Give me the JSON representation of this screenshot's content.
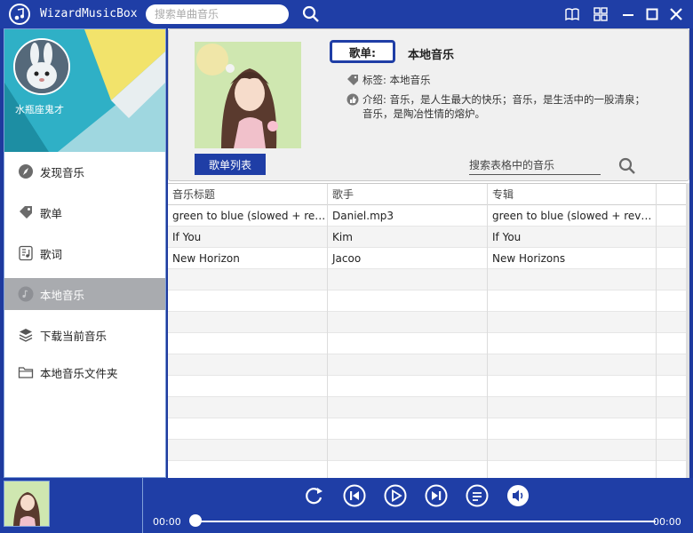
{
  "app": {
    "title": "WizardMusicBox",
    "search_placeholder": "搜索单曲音乐"
  },
  "profile": {
    "user_name": "水瓶座鬼才"
  },
  "nav": [
    {
      "label": "发现音乐",
      "icon": "compass-icon"
    },
    {
      "label": "歌单",
      "icon": "tag-icon"
    },
    {
      "label": "歌词",
      "icon": "lyrics-icon"
    },
    {
      "label": "本地音乐",
      "icon": "local-music-icon",
      "active": true
    },
    {
      "label": "下载当前音乐",
      "icon": "download-stack-icon"
    },
    {
      "label": "本地音乐文件夹",
      "icon": "folder-icon"
    }
  ],
  "album": {
    "badge": "歌单:",
    "name": "本地音乐",
    "tag_label": "标签: 本地音乐",
    "intro_label": "介绍: 音乐，是人生最大的快乐；音乐，是生活中的一股清泉；音乐，是陶冶性情的熔炉。",
    "list_tab": "歌单列表",
    "table_search_placeholder": "搜索表格中的音乐"
  },
  "table": {
    "columns": [
      "音乐标题",
      "歌手",
      "专辑"
    ],
    "rows": [
      [
        "green to blue (slowed + reverb)",
        "Daniel.mp3",
        "green to blue (slowed + reverb)"
      ],
      [
        "If You",
        "Kim",
        "If You"
      ],
      [
        "New Horizon",
        "Jacoo",
        "New Horizons"
      ]
    ]
  },
  "player": {
    "time_current": "00:00",
    "time_total": "00:00",
    "progress": 0
  },
  "colors": {
    "primary": "#1f3ea6",
    "nav_active": "#a9abaf",
    "profile_bg": "#3fb6c9"
  }
}
